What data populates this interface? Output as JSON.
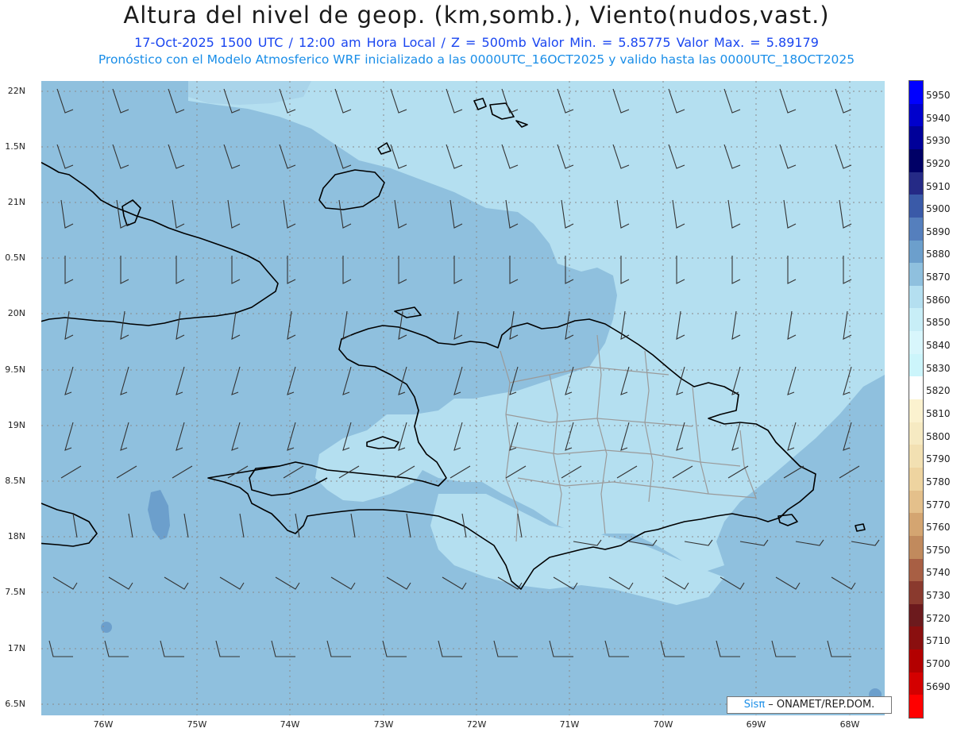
{
  "header": {
    "title": "Altura del nivel de geop. (km,somb.), Viento(nudos,vast.)",
    "subtitle": "17-Oct-2025  1500 UTC / 12:00 am Hora Local / Z = 500mb    Valor Min. = 5.85775  Valor Max. = 5.89179",
    "description": "Pronóstico con el Modelo Atmosferico WRF inicializado a las 0000UTC_16OCT2025 y valido hasta las  0000UTC_18OCT2025"
  },
  "map": {
    "lat_labels": [
      "22N",
      "1.5N",
      "21N",
      "0.5N",
      "20N",
      "9.5N",
      "19N",
      "8.5N",
      "18N",
      "7.5N",
      "17N",
      "6.5N"
    ],
    "lon_labels": [
      "76W",
      "75W",
      "74W",
      "73W",
      "72W",
      "71W",
      "70W",
      "69W",
      "68W"
    ],
    "colors": {
      "shade_5870_5880": "#8fc0de",
      "shade_5860_5870": "#b4dff0",
      "shade_5880_5890": "#6c9fcc",
      "coastline": "#000000",
      "province_border": "#9a9a9a"
    }
  },
  "colorbar": {
    "labels": [
      "5950",
      "5940",
      "5930",
      "5920",
      "5910",
      "5900",
      "5890",
      "5880",
      "5870",
      "5860",
      "5850",
      "5840",
      "5830",
      "5820",
      "5810",
      "5800",
      "5790",
      "5780",
      "5770",
      "5760",
      "5750",
      "5740",
      "5730",
      "5720",
      "5710",
      "5700",
      "5690"
    ],
    "colors": [
      "#0000ff",
      "#0000cc",
      "#000099",
      "#000066",
      "#252a86",
      "#3a5aa8",
      "#557fbd",
      "#6c9fcc",
      "#8fc0de",
      "#b4dff0",
      "#c8eef7",
      "#d8f6fc",
      "#ccf5fb",
      "#ffffff",
      "#fbf2cf",
      "#f6eac2",
      "#f2e0b2",
      "#eed4a0",
      "#e4c08b",
      "#d4a571",
      "#c18a5d",
      "#a85f44",
      "#8a3a2e",
      "#6c1a1d",
      "#8a0f0f",
      "#b30000",
      "#d40000",
      "#ff0000"
    ]
  },
  "credit": {
    "sis": "Sisπ",
    "org": " – ONAMET/REP.DOM."
  }
}
